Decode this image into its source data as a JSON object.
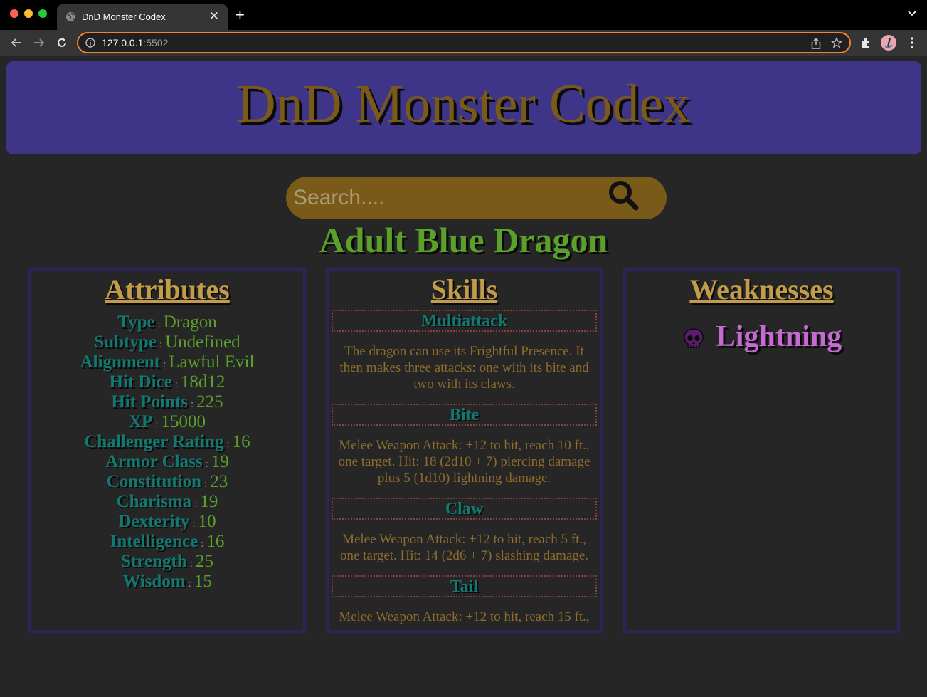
{
  "browser": {
    "tab_title": "DnD Monster Codex",
    "tab_close": "✕",
    "new_tab": "+",
    "url_host": "127.0.0.1",
    "url_port": ":5502"
  },
  "header": {
    "title": "DnD Monster Codex"
  },
  "search": {
    "placeholder": "Search...."
  },
  "monster": {
    "name": "Adult Blue Dragon"
  },
  "attributes": {
    "heading": "Attributes",
    "separator": ":",
    "items": [
      {
        "key": "Type",
        "value": "Dragon"
      },
      {
        "key": "Subtype",
        "value": "Undefined"
      },
      {
        "key": "Alignment",
        "value": "Lawful Evil"
      },
      {
        "key": "Hit Dice",
        "value": "18d12"
      },
      {
        "key": "Hit Points",
        "value": "225"
      },
      {
        "key": "XP",
        "value": "15000"
      },
      {
        "key": "Challenger Rating",
        "value": "16"
      },
      {
        "key": "Armor Class",
        "value": "19"
      },
      {
        "key": "Constitution",
        "value": "23"
      },
      {
        "key": "Charisma",
        "value": "19"
      },
      {
        "key": "Dexterity",
        "value": "10"
      },
      {
        "key": "Intelligence",
        "value": "16"
      },
      {
        "key": "Strength",
        "value": "25"
      },
      {
        "key": "Wisdom",
        "value": "15"
      }
    ]
  },
  "skills": {
    "heading": "Skills",
    "items": [
      {
        "name": "Multiattack",
        "desc": "The dragon can use its Frightful Presence. It then makes three attacks: one with its bite and two with its claws."
      },
      {
        "name": "Bite",
        "desc": "Melee Weapon Attack: +12 to hit, reach 10 ft., one target. Hit: 18 (2d10 + 7) piercing damage plus 5 (1d10) lightning damage."
      },
      {
        "name": "Claw",
        "desc": "Melee Weapon Attack: +12 to hit, reach 5 ft., one target. Hit: 14 (2d6 + 7) slashing damage."
      },
      {
        "name": "Tail",
        "desc": "Melee Weapon Attack: +12 to hit, reach 15 ft.,"
      }
    ]
  },
  "weaknesses": {
    "heading": "Weaknesses",
    "items": [
      {
        "label": "Lightning",
        "icon": "skull-icon"
      }
    ]
  },
  "colors": {
    "banner": "#3e3589",
    "title": "#7a5a18",
    "monster_name": "#5ba02a",
    "teal": "#107a72",
    "weakness": "#c46ad0"
  }
}
